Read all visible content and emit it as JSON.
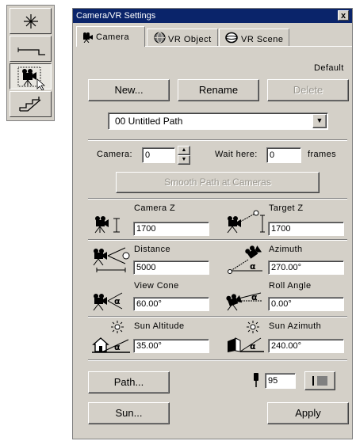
{
  "toolbox": {
    "tools": [
      {
        "icon": "asterisk-icon"
      },
      {
        "icon": "path-line-icon"
      },
      {
        "icon": "camera-icon",
        "pressed": true
      },
      {
        "icon": "stairs-icon"
      }
    ]
  },
  "window": {
    "title": "Camera/VR Settings",
    "close": "x"
  },
  "tabs": [
    {
      "label": "Camera",
      "active": true
    },
    {
      "label": "VR Object",
      "active": false
    },
    {
      "label": "VR Scene",
      "active": false
    }
  ],
  "path_section": {
    "default_label": "Default",
    "new_label": "New...",
    "rename_label": "Rename",
    "delete_label": "Delete",
    "selected_path": "00  Untitled Path"
  },
  "camera_row": {
    "camera_label": "Camera:",
    "camera_value": "0",
    "wait_label": "Wait here:",
    "wait_value": "0",
    "frames_label": "frames"
  },
  "smooth_label": "Smooth Path at Cameras",
  "params": {
    "camera_z": {
      "label": "Camera Z",
      "value": "1700"
    },
    "target_z": {
      "label": "Target Z",
      "value": "1700"
    },
    "distance": {
      "label": "Distance",
      "value": "5000"
    },
    "azimuth": {
      "label": "Azimuth",
      "value": "270.00°"
    },
    "view_cone": {
      "label": "View Cone",
      "value": "60.00°"
    },
    "roll_angle": {
      "label": "Roll Angle",
      "value": "0.00°"
    },
    "sun_altitude": {
      "label": "Sun Altitude",
      "value": "35.00°"
    },
    "sun_azimuth": {
      "label": "Sun Azimuth",
      "value": "240.00°"
    }
  },
  "bottom": {
    "path_label": "Path...",
    "sun_label": "Sun...",
    "apply_label": "Apply",
    "height_value": "95"
  },
  "colors": {
    "titlebar": "#0a246a",
    "face": "#d4d0c8"
  }
}
